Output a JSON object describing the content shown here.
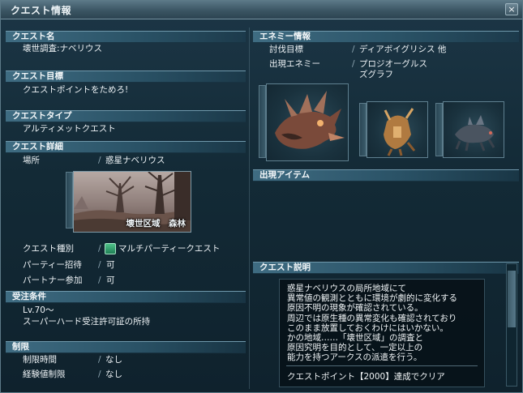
{
  "window": {
    "title": "クエスト情報",
    "close_label": "×"
  },
  "left": {
    "quest_name": {
      "header": "クエスト名",
      "value": "壊世調査:ナベリウス"
    },
    "quest_goal": {
      "header": "クエスト目標",
      "value": "クエストポイントをためろ!"
    },
    "quest_type": {
      "header": "クエストタイプ",
      "value": "アルティメットクエスト"
    },
    "quest_detail": {
      "header": "クエスト詳細",
      "location_label": "場所",
      "location_value": "惑星ナベリウス",
      "area_caption": "壊世区域　森林",
      "kind_label": "クエスト種別",
      "kind_value": "マルチパーティークエスト",
      "party_invite_label": "パーティー招待",
      "party_invite_value": "可",
      "partner_label": "パートナー参加",
      "partner_value": "可",
      "separator": "/"
    },
    "conditions": {
      "header": "受注条件",
      "lines": [
        "Lv.70～",
        "スーパーハード受注許可証の所持"
      ]
    },
    "limits": {
      "header": "制限",
      "time_label": "制限時間",
      "time_value": "なし",
      "exp_label": "経験値制限",
      "exp_value": "なし"
    }
  },
  "right": {
    "enemy_info": {
      "header": "エネミー情報",
      "target_label": "討伐目標",
      "target_value": "ディアボイグリシス 他",
      "enemies_label": "出現エネミー",
      "enemies_value": [
        "プロジオーグルス",
        "ズグラフ"
      ]
    },
    "items": {
      "header": "出現アイテム"
    },
    "description": {
      "header": "クエスト説明",
      "lines": [
        "惑星ナベリウスの局所地域にて",
        "異常値の観測とともに環境が劇的に変化する",
        "原因不明の現象が確認されている。",
        "周辺では原生種の異常変化も確認されており",
        "このまま放置しておくわけにはいかない。",
        "かの地域……「壊世区域」の調査と",
        "原因究明を目的として、一定以上の",
        "能力を持つアークスの派遣を行う。"
      ],
      "clear_condition": "クエストポイント【2000】達成でクリア"
    }
  },
  "colors": {
    "header_bg": "#2a5266",
    "panel_bg": "#132a36",
    "text": "#eef3f6"
  }
}
